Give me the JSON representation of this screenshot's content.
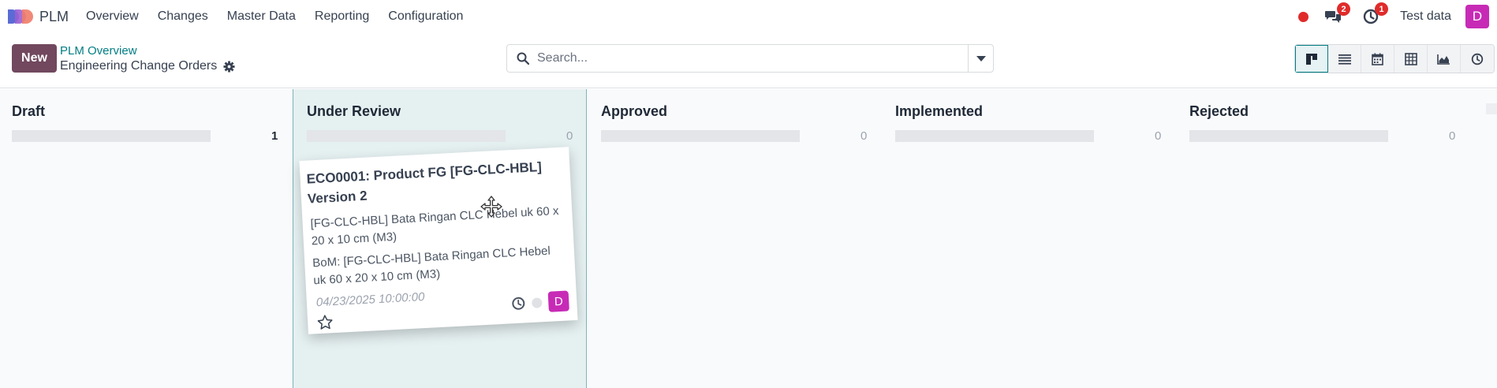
{
  "navbar": {
    "app_name": "PLM",
    "menu": [
      "Overview",
      "Changes",
      "Master Data",
      "Reporting",
      "Configuration"
    ],
    "messages_badge": "2",
    "activities_badge": "1",
    "database_name": "Test data",
    "user_initial": "D"
  },
  "control_panel": {
    "new_button": "New",
    "breadcrumb": "PLM Overview",
    "title": "Engineering Change Orders",
    "search_placeholder": "Search...",
    "views": [
      "kanban-icon",
      "list-icon",
      "calendar-icon",
      "pivot-icon",
      "graph-icon",
      "activity-icon"
    ],
    "active_view": "kanban-icon"
  },
  "kanban": {
    "columns": [
      {
        "title": "Draft",
        "count": "1"
      },
      {
        "title": "Under Review",
        "count": "0"
      },
      {
        "title": "Approved",
        "count": "0"
      },
      {
        "title": "Implemented",
        "count": "0"
      },
      {
        "title": "Rejected",
        "count": "0"
      }
    ],
    "card": {
      "title": "ECO0001: Product FG [FG-CLC-HBL] Version 2",
      "product": "[FG-CLC-HBL] Bata Ringan CLC Hebel uk 60 x 20 x 10 cm (M3)",
      "bom": "BoM: [FG-CLC-HBL] Bata Ringan CLC Hebel uk 60 x 20 x 10 cm (M3)",
      "date": "04/23/2025 10:00:00",
      "assignee_initial": "D"
    }
  },
  "colors": {
    "primary": "#71485e",
    "accent": "#017e84",
    "badge": "#e02b2b",
    "avatar": "#c72bb6"
  }
}
